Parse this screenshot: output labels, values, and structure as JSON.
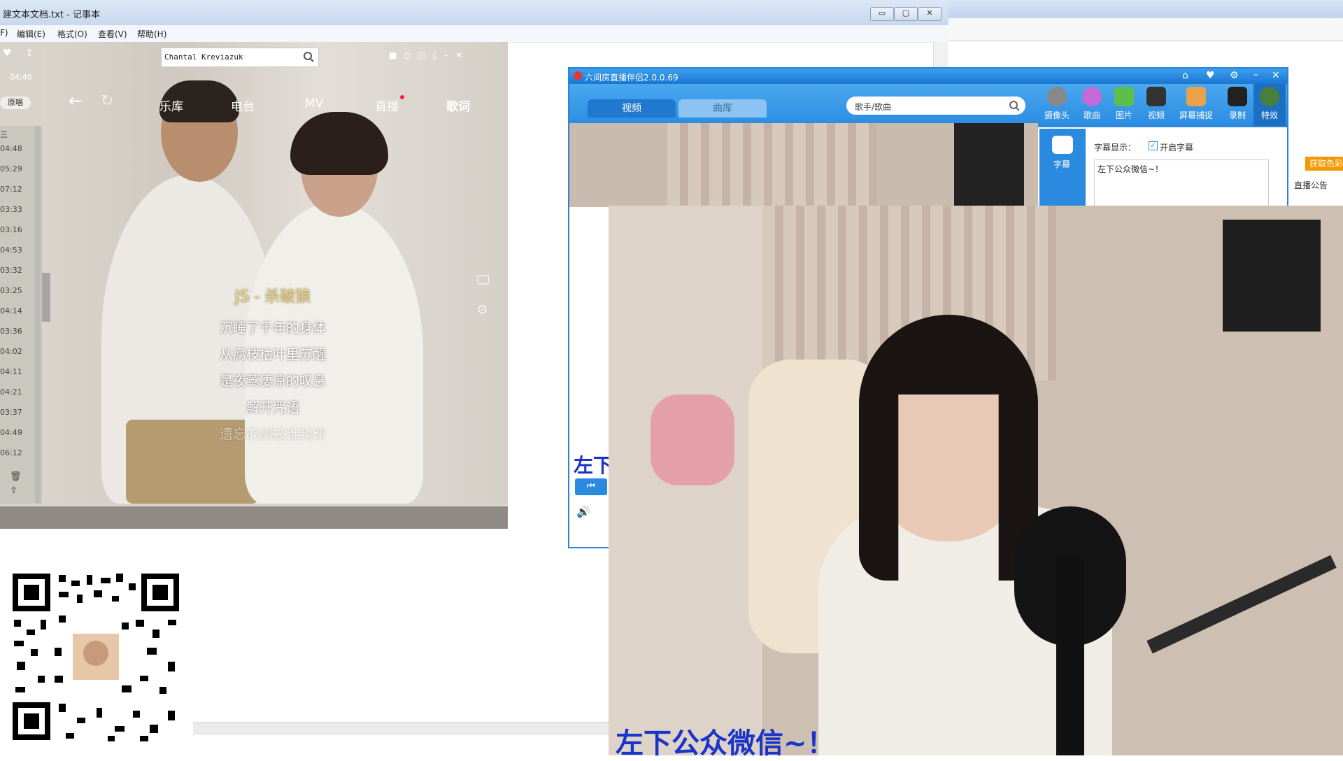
{
  "notepad": {
    "title": "建文本文档.txt - 记事本",
    "menu": [
      "F)",
      "编辑(E)",
      "格式(O)",
      "查看(V)",
      "帮助(H)"
    ],
    "win_buttons": [
      "▭",
      "▢",
      "✕"
    ]
  },
  "player": {
    "search_value": "Chantal Kreviazuk",
    "time": "04:40",
    "source_label": "原唱",
    "nav": [
      "乐库",
      "电台",
      "MV",
      "直播",
      "歌词"
    ],
    "lyric_title": "JS - 杀破狼",
    "lyrics": [
      "沉睡了千年的身体",
      "从腐枝枯叶里苏醒",
      "是夜莺凄凉的叹息",
      "解开咒语",
      "遗忘的剑被谁封印"
    ],
    "durations": [
      "04:48",
      "05:29",
      "07:12",
      "03:33",
      "03:16",
      "04:53",
      "03:32",
      "03:25",
      "04:14",
      "03:36",
      "04:02",
      "04:11",
      "04:21",
      "03:37",
      "04:49",
      "06:12"
    ],
    "list_header": "三",
    "window_controls": [
      "■",
      "◻",
      "◫",
      "▯",
      "–",
      "✕"
    ]
  },
  "live": {
    "title": "六间房直播伴侣2.0.0.69",
    "tabs": [
      "视频",
      "曲库"
    ],
    "search_placeholder": "歌手/歌曲",
    "tools": [
      "摄像头",
      "歌曲",
      "图片",
      "视频",
      "屏幕捕捉",
      "录制",
      "特效"
    ],
    "side_label": "字幕",
    "subtitle_label": "字幕显示：",
    "subtitle_toggle": "开启字幕",
    "subtitle_text": "左下公众微信~！",
    "small_overlay": "左下",
    "title_buttons": [
      "⌂",
      "♥",
      "⚙",
      "–",
      "✕"
    ]
  },
  "background": {
    "get_btn": "获取色彩",
    "notice": "直播公告"
  },
  "video": {
    "subtitle": "左下公众微信~！"
  },
  "colors": {
    "live_blue": "#2a8ae0",
    "subtitle_blue": "#1a33c8",
    "lyric_title": "#f3d36b"
  }
}
